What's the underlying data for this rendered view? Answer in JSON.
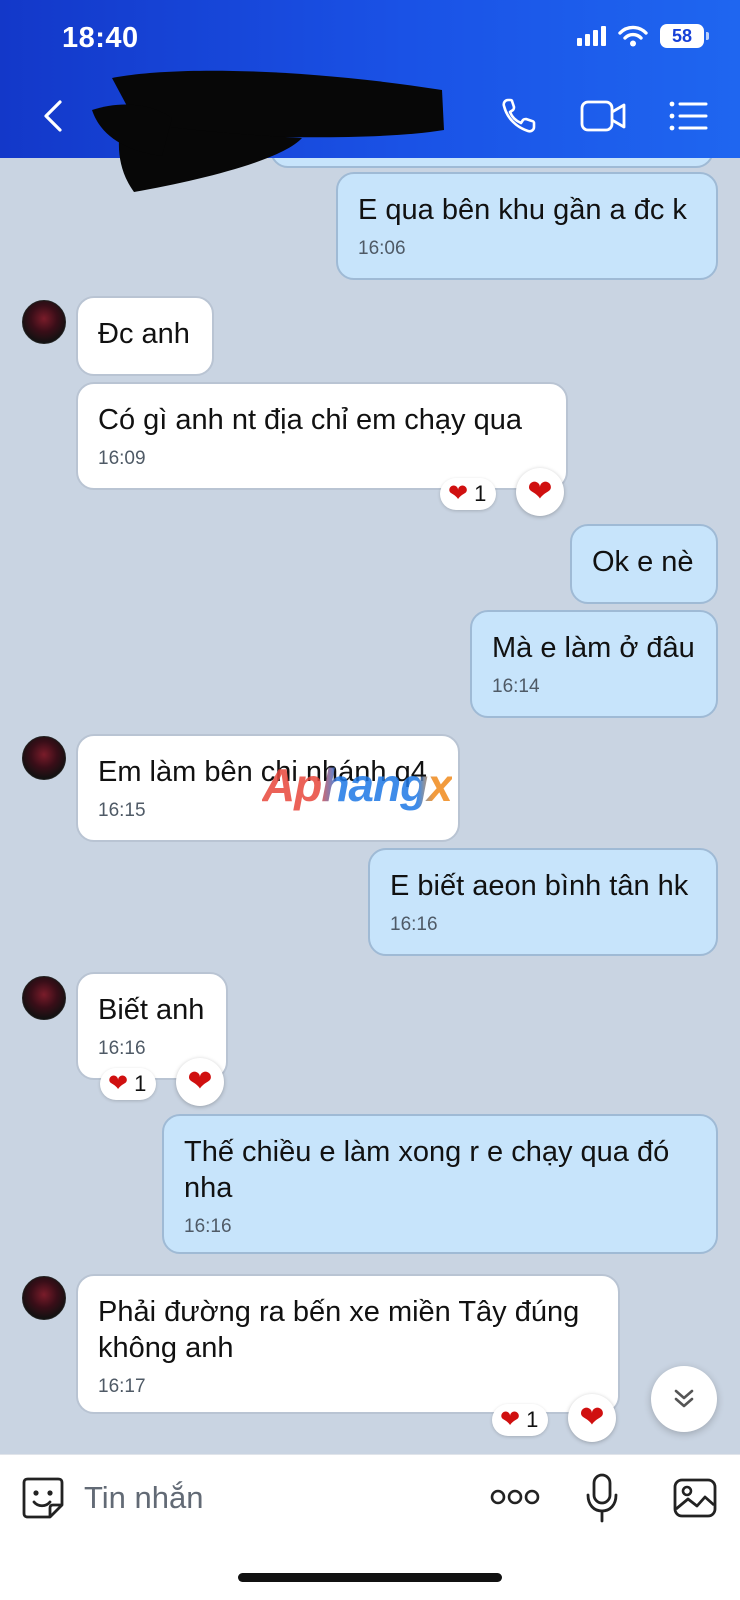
{
  "status_bar": {
    "time": "18:40",
    "battery": "58"
  },
  "header": {
    "contact_name": ""
  },
  "messages": [
    {
      "side": "out",
      "text": "E qua bên khu gần a đc k",
      "time": "16:06"
    },
    {
      "side": "in",
      "text": "Đc anh",
      "time": ""
    },
    {
      "side": "in",
      "text": "Có gì anh nt địa chỉ em chạy qua",
      "time": "16:09",
      "reaction_count": "1"
    },
    {
      "side": "out",
      "text": "Ok e nè",
      "time": ""
    },
    {
      "side": "out",
      "text": "Mà e làm ở đâu",
      "time": "16:14"
    },
    {
      "side": "in",
      "text": "Em làm bên chi nhánh q4",
      "time": "16:15"
    },
    {
      "side": "out",
      "text": "E biết aeon bình tân hk",
      "time": "16:16"
    },
    {
      "side": "in",
      "text": "Biết anh",
      "time": "16:16",
      "reaction_count": "1"
    },
    {
      "side": "out",
      "text": "Thế chiều e làm xong r e chạy qua đó nha",
      "time": "16:16"
    },
    {
      "side": "in",
      "text": "Phải đường ra bến xe miền Tây đúng không anh",
      "time": "16:17",
      "reaction_count": "1"
    }
  ],
  "watermark": "Aphangx",
  "composer": {
    "placeholder": "Tin nhắn"
  },
  "icons": {
    "back": "chevron-left-icon",
    "call": "phone-icon",
    "video": "video-camera-icon",
    "menu": "list-menu-icon",
    "sticker": "smiley-sticker-icon",
    "more": "more-dots-icon",
    "mic": "microphone-icon",
    "image": "image-icon",
    "scroll": "double-chevron-down-icon",
    "reaction": "heart-icon"
  },
  "colors": {
    "header": "#1a4fe3",
    "outgoing_bubble": "#c7e4fb",
    "incoming_bubble": "#ffffff",
    "chat_bg": "#c9d4e2",
    "heart": "#d01010"
  }
}
